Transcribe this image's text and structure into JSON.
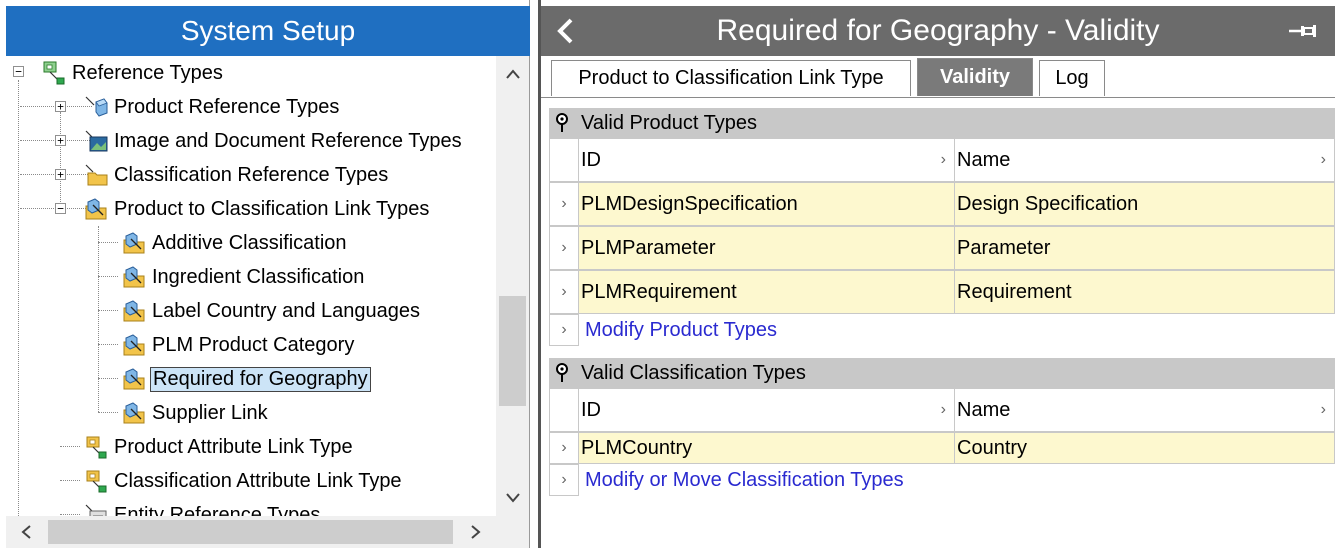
{
  "left_panel": {
    "title": "System Setup",
    "tree": [
      {
        "label": "Reference Types",
        "icon": "reference-types-icon"
      },
      {
        "label": "Product Reference Types",
        "icon": "product-reference-icon"
      },
      {
        "label": "Image and Document Reference Types",
        "icon": "image-reference-icon"
      },
      {
        "label": "Classification Reference Types",
        "icon": "folder-reference-icon"
      },
      {
        "label": "Product to Classification Link Types",
        "icon": "link-type-icon"
      },
      {
        "label": "Additive Classification",
        "icon": "link-type-icon"
      },
      {
        "label": "Ingredient Classification",
        "icon": "link-type-icon"
      },
      {
        "label": "Label Country and Languages",
        "icon": "link-type-icon"
      },
      {
        "label": "PLM Product Category",
        "icon": "link-type-icon"
      },
      {
        "label": "Required for Geography",
        "icon": "link-type-icon",
        "selected": true
      },
      {
        "label": "Supplier Link",
        "icon": "link-type-icon"
      },
      {
        "label": "Product Attribute Link Type",
        "icon": "attribute-link-icon"
      },
      {
        "label": "Classification Attribute Link Type",
        "icon": "attribute-link-icon"
      },
      {
        "label": "Entity Reference Types",
        "icon": "entity-reference-icon"
      }
    ]
  },
  "right_panel": {
    "title": "Required for Geography - Validity",
    "tabs": [
      {
        "label": "Product to Classification Link Type",
        "active": false
      },
      {
        "label": "Validity",
        "active": true
      },
      {
        "label": "Log",
        "active": false
      }
    ],
    "product_section": {
      "title": "Valid Product Types",
      "columns": [
        "ID",
        "Name"
      ],
      "rows": [
        {
          "id": "PLMDesignSpecification",
          "name": "Design Specification"
        },
        {
          "id": "PLMParameter",
          "name": "Parameter"
        },
        {
          "id": "PLMRequirement",
          "name": "Requirement"
        }
      ],
      "action": "Modify Product Types"
    },
    "classification_section": {
      "title": "Valid Classification Types",
      "columns": [
        "ID",
        "Name"
      ],
      "rows": [
        {
          "id": "PLMCountry",
          "name": "Country"
        }
      ],
      "action": "Modify or Move Classification Types"
    }
  },
  "colors": {
    "left_title_bg": "#1f6fc1",
    "right_title_bg": "#6b6b6b",
    "data_row_bg": "#fdf8cf",
    "section_header_bg": "#c8c8c8",
    "link_color": "#2a2ad0"
  }
}
